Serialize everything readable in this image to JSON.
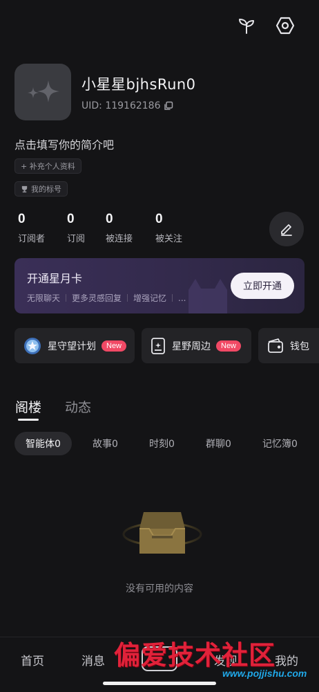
{
  "header": {
    "icons": [
      "sprout-icon",
      "settings-hex-icon"
    ]
  },
  "profile": {
    "nickname": "小星星bjhsRun0",
    "uid": "UID: 119162186",
    "bio": "点击填写你的简介吧",
    "chips": {
      "supplement": "+ 补充个人资料",
      "badges": "我的标号"
    }
  },
  "stats": [
    {
      "value": "0",
      "label": "订阅者"
    },
    {
      "value": "0",
      "label": "订阅"
    },
    {
      "value": "0",
      "label": "被连接"
    },
    {
      "value": "0",
      "label": "被关注"
    }
  ],
  "promo": {
    "title": "开通星月卡",
    "features": [
      "无限聊天",
      "更多灵感回复",
      "增强记忆",
      "..."
    ],
    "button": "立即开通"
  },
  "shortcuts": [
    {
      "label": "星守望计划",
      "badge": "New"
    },
    {
      "label": "星野周边",
      "badge": "New"
    },
    {
      "label": "钱包"
    }
  ],
  "tabs": {
    "items": [
      "阁楼",
      "动态"
    ],
    "active": "阁楼"
  },
  "filters": [
    "智能体0",
    "故事0",
    "时刻0",
    "群聊0",
    "记忆簿0"
  ],
  "empty_state": {
    "text": "没有可用的内容"
  },
  "bottom_nav": {
    "items": [
      "首页",
      "消息",
      "",
      "发现",
      "我的"
    ]
  },
  "watermark": {
    "title": "偏爱技术社区",
    "url": "www.pojjishu.com"
  },
  "colors": {
    "background": "#141416",
    "promo": "#3a2f57",
    "badge": "#f14965"
  }
}
